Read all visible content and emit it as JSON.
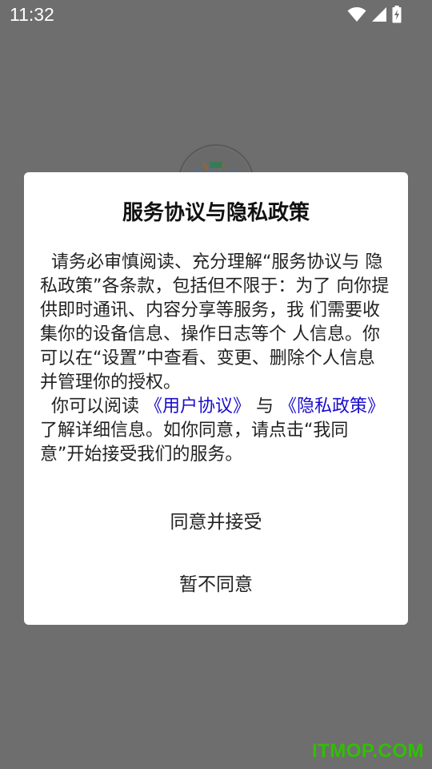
{
  "status_bar": {
    "time": "11:32",
    "icons": [
      "wifi-icon",
      "cell-signal-icon",
      "battery-charging-icon"
    ]
  },
  "dialog": {
    "title": "服务协议与隐私政策",
    "paragraph1": "  请务必审慎阅读、充分理解“服务协议与 隐私政策”各条款，包括但不限于：为了 向你提供即时通讯、内容分享等服务，我 们需要收集你的设备信息、操作日志等个 人信息。你可以在“设置”中查看、变更、删除个人信息并管理你的授权。",
    "paragraph2_prefix": "  你可以阅读",
    "user_agreement_link": "《用户协议》",
    "and_text": "与",
    "privacy_policy_link": "《隐私政策》",
    "paragraph2_suffix": "了解详细信息。如你同意，请点击“我同意”开始接受我们的服务。",
    "agree_button": "同意并接受",
    "disagree_button": "暂不同意"
  },
  "watermark": "ITMOP.COM",
  "colors": {
    "overlay_background": "#6e6e6e",
    "link": "#1a0dcc",
    "watermark": "#2fc000"
  }
}
